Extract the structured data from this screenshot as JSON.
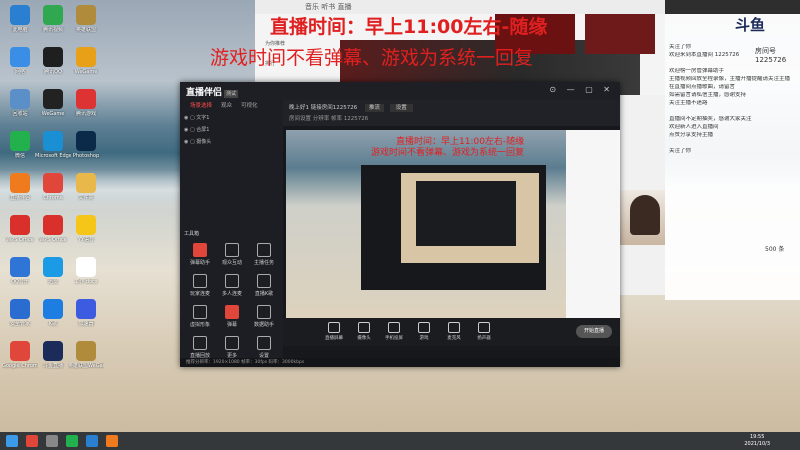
{
  "overlay": {
    "line1": "直播时间：早上11:00左右-随缘",
    "line2": "游戏时间不看弹幕、游戏为系统一回复"
  },
  "desktop": {
    "icons": [
      {
        "label": "此电脑",
        "color": "#2a7fd0"
      },
      {
        "label": "腾讯视频",
        "color": "#2fa84f"
      },
      {
        "label": "英雄联盟",
        "color": "#b08b3c"
      },
      {
        "label": "网络",
        "color": "#3a8ee6"
      },
      {
        "label": "腾讯QQ",
        "color": "#1f1f1f"
      },
      {
        "label": "WeGame",
        "color": "#e8a018"
      },
      {
        "label": "回收站",
        "color": "#5a8fc8"
      },
      {
        "label": "WeGame",
        "color": "#222"
      },
      {
        "label": "腾讯游戏",
        "color": "#d33"
      },
      {
        "label": "微信",
        "color": "#23b14d"
      },
      {
        "label": "Microsoft Edge",
        "color": "#1b8fd4"
      },
      {
        "label": "Photoshop",
        "color": "#0b2a4a"
      },
      {
        "label": "直播伴侣",
        "color": "#f07a1e"
      },
      {
        "label": "Chrome",
        "color": "#e0463a"
      },
      {
        "label": "文件夹",
        "color": "#e8b84a"
      },
      {
        "label": "WPS Office",
        "color": "#d9302c"
      },
      {
        "label": "WPS Office",
        "color": "#d9302c"
      },
      {
        "label": "YY语音",
        "color": "#f5c518"
      },
      {
        "label": "QQ音乐",
        "color": "#2f75d6"
      },
      {
        "label": "迅雷",
        "color": "#1b9be6"
      },
      {
        "label": "工作.docx",
        "color": "#fff"
      },
      {
        "label": "安全管家",
        "color": "#2b6cd1"
      },
      {
        "label": "K歌",
        "color": "#1d7de0"
      },
      {
        "label": "加速器",
        "color": "#3d5be0"
      },
      {
        "label": "Google Chrome",
        "color": "#e0463a"
      },
      {
        "label": "斗鱼直播",
        "color": "#1b2c5a"
      },
      {
        "label": "英雄联盟WeGame",
        "color": "#b08b3c"
      }
    ]
  },
  "bg_browser": {
    "tab_labels": "音乐   听书   直播",
    "item1": "为你推荐",
    "item2": "排行"
  },
  "chat": {
    "brand": "斗鱼",
    "room_label": "房间号",
    "room_id": "1225726",
    "messages": [
      "关注了你",
      "欢迎来到本直播间 1225726",
      "",
      "欢迎榜一房管弹幕助手",
      "主播视频回放全程录像，主播开播提醒请关注主播",
      "在直播间点播歌曲，请留言",
      "如需留言请私信主播，感谢支持",
      "关注主播不迷路",
      "",
      "直播间不定期抽奖，感谢大家关注",
      "欢迎新人进入直播间",
      "点赞分享支持主播",
      "",
      "关注了你"
    ],
    "footer_count": "500",
    "footer_unit": "条"
  },
  "app": {
    "title": "直播伴侣",
    "badge": "测试",
    "window_controls": "⊙ — ▢ ✕",
    "side_tabs": [
      "场景选择",
      "观众",
      "可视化"
    ],
    "scenes": [
      "文字1",
      "合屏1",
      "摄像头"
    ],
    "tools_title": "工具箱",
    "tools": [
      {
        "label": "弹幕助手",
        "red": true
      },
      {
        "label": "观众互动",
        "red": false
      },
      {
        "label": "主播任务",
        "red": false
      },
      {
        "label": "玩家连麦",
        "red": false
      },
      {
        "label": "多人连麦",
        "red": false
      },
      {
        "label": "直播K歌",
        "red": false
      },
      {
        "label": "虚拟形象",
        "red": false
      },
      {
        "label": "弹幕",
        "red": true
      },
      {
        "label": "数据助手",
        "red": false
      },
      {
        "label": "直播回放",
        "red": false
      },
      {
        "label": "更多",
        "red": false
      },
      {
        "label": "设置",
        "red": false
      }
    ],
    "info_line1": "晚上好1  链接房间1225726",
    "info_btn1": "推流",
    "info_btn2": "设置",
    "info_line2": "房间设置   分辨率   帧率   1225726",
    "preview_line1": "直播时间：早上11:00左右-随缘",
    "preview_line2": "游戏时间不看弹幕、游戏为系统一回复",
    "bottom_buttons": [
      "直播屏幕",
      "摄像头",
      "手机投屏",
      "游戏",
      "麦克风",
      "扬声器"
    ],
    "go_live": "开始直播",
    "status_text": "推荐分辨率：1920×1080   帧率：30fps   码率：3000kbps"
  },
  "taskbar": {
    "time": "19:55",
    "date": "2021/10/3"
  }
}
